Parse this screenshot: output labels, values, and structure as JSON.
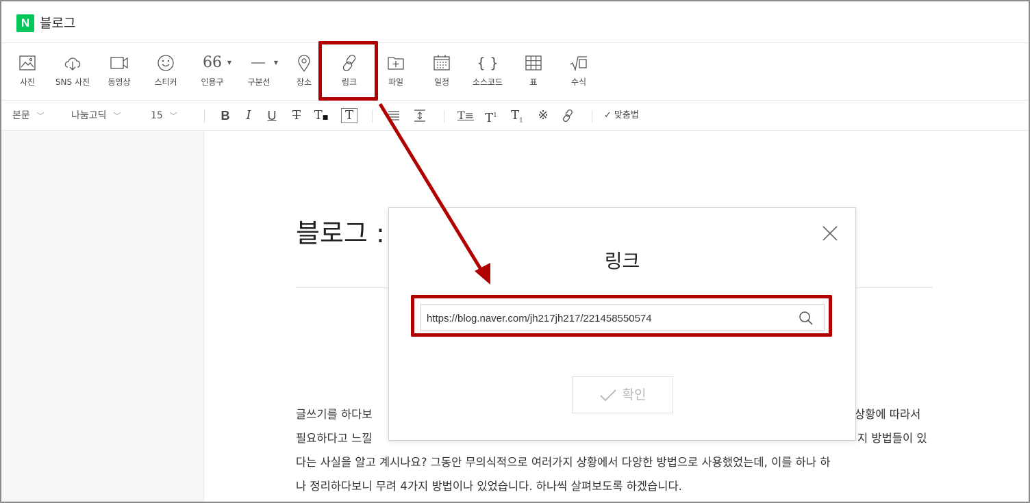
{
  "header": {
    "logo": "N",
    "title": "블로그"
  },
  "toolbar": [
    {
      "label": "사진",
      "icon": "photo-icon"
    },
    {
      "label": "SNS 사진",
      "icon": "cloud-download-icon"
    },
    {
      "label": "동영상",
      "icon": "video-icon"
    },
    {
      "label": "스티커",
      "icon": "smiley-icon"
    },
    {
      "label": "인용구",
      "icon": "quote-icon",
      "glyph": "66"
    },
    {
      "label": "구분선",
      "icon": "divider-line-icon"
    },
    {
      "label": "장소",
      "icon": "map-pin-icon"
    },
    {
      "label": "링크",
      "icon": "link-icon"
    },
    {
      "label": "파일",
      "icon": "file-add-icon"
    },
    {
      "label": "일정",
      "icon": "calendar-icon"
    },
    {
      "label": "소스코드",
      "icon": "code-braces-icon",
      "glyph": "{ }"
    },
    {
      "label": "표",
      "icon": "table-icon"
    },
    {
      "label": "수식",
      "icon": "math-formula-icon"
    }
  ],
  "format": {
    "paragraph": "본문",
    "font": "나눔고딕",
    "size": "15",
    "spellcheck": "맞춤법"
  },
  "post": {
    "title": "블로그 :",
    "lines": [
      "글쓰기를 하다보",
      "필요하다고 느낄",
      "다는 사실을 알고 계시나요? 그동안 무의식적으로 여러가지 상황에서 다양한 방법으로 사용했었는데, 이를 하나 하",
      "나 정리하다보니 무려 4가지 방법이나 있었습니다. 하나씩 살펴보도록 하겠습니다."
    ],
    "right_fragments": [
      "상황에 따라서",
      "지 방법들이 있"
    ]
  },
  "modal": {
    "title": "링크",
    "url": "https://blog.naver.com/jh217jh217/221458550574",
    "confirm": "확인"
  },
  "colors": {
    "highlight": "#b00000",
    "brand": "#03c75a"
  }
}
